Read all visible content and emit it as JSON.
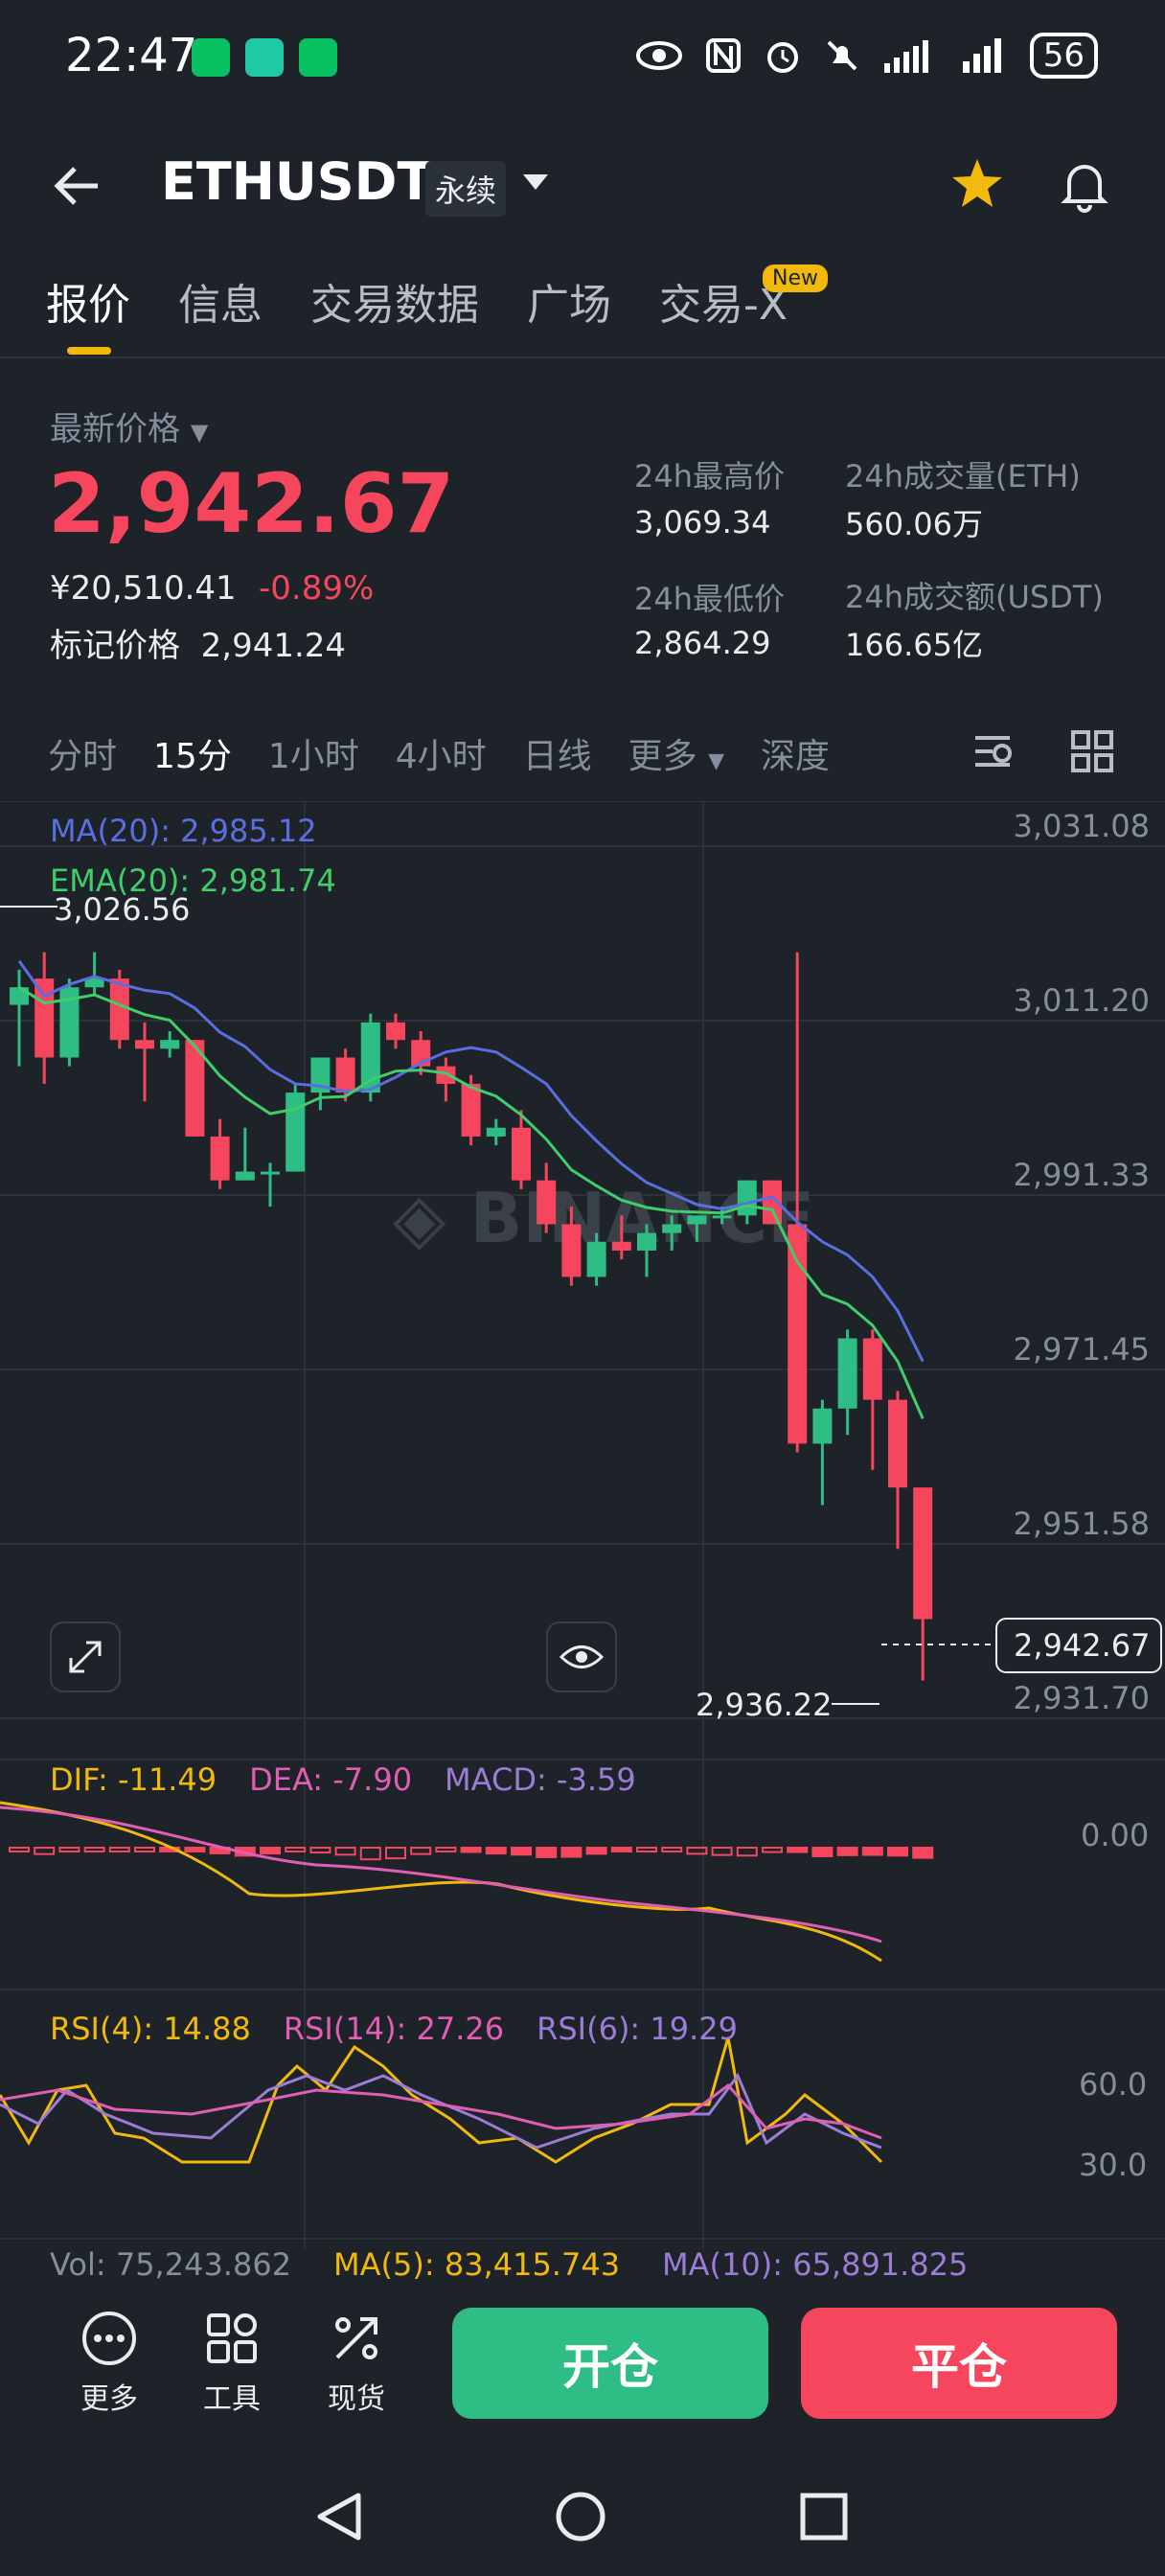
{
  "status": {
    "time": "22:47",
    "battery": "56"
  },
  "header": {
    "pair": "ETHUSDT",
    "contract_type": "永续"
  },
  "tabs": [
    {
      "label": "报价"
    },
    {
      "label": "信息"
    },
    {
      "label": "交易数据"
    },
    {
      "label": "广场"
    },
    {
      "label": "交易-X"
    }
  ],
  "new_badge": "New",
  "price_block": {
    "latest_label": "最新价格",
    "last_price": "2,942.67",
    "cny_price": "¥20,510.41",
    "change_pct": "-0.89%",
    "mark_label": "标记价格",
    "mark_price": "2,941.24"
  },
  "stats": {
    "high_label": "24h最高价",
    "high": "3,069.34",
    "low_label": "24h最低价",
    "low": "2,864.29",
    "vol_eth_label": "24h成交量(ETH)",
    "vol_eth": "560.06万",
    "vol_usdt_label": "24h成交额(USDT)",
    "vol_usdt": "166.65亿"
  },
  "intervals": [
    "分时",
    "15分",
    "1小时",
    "4小时",
    "日线",
    "更多",
    "深度"
  ],
  "chart_data": {
    "type": "candlestick",
    "ma_legend": "MA(20): 2,985.12",
    "ema_legend": "EMA(20): 2,981.74",
    "y_ticks": [
      "3,031.08",
      "3,011.20",
      "2,991.33",
      "2,971.45",
      "2,951.58",
      "2,931.70"
    ],
    "ylim": [
      2931.7,
      3031.08
    ],
    "high_annotation": "3,026.56",
    "low_annotation": "2,936.22",
    "current_price_tag": "2,942.67",
    "candles": [
      [
        3013,
        3017,
        3006,
        3015
      ],
      [
        3016,
        3019,
        3004,
        3007
      ],
      [
        3007,
        3016,
        3006,
        3015
      ],
      [
        3015,
        3019,
        3014,
        3016
      ],
      [
        3016,
        3017,
        3008,
        3009
      ],
      [
        3009,
        3011,
        3002,
        3008
      ],
      [
        3008,
        3010,
        3007,
        3009
      ],
      [
        3009,
        3009,
        2998,
        2998
      ],
      [
        2998,
        3000,
        2992,
        2993
      ],
      [
        2993,
        2999,
        2993,
        2994
      ],
      [
        2994,
        2995,
        2990,
        2994
      ],
      [
        2994,
        3004,
        2994,
        3003
      ],
      [
        3003,
        3007,
        3001,
        3007
      ],
      [
        3007,
        3008,
        3002,
        3003
      ],
      [
        3003,
        3012,
        3002,
        3011
      ],
      [
        3011,
        3012,
        3008,
        3009
      ],
      [
        3009,
        3010,
        3005,
        3006
      ],
      [
        3006,
        3007,
        3002,
        3004
      ],
      [
        3004,
        3005,
        2997,
        2998
      ],
      [
        2998,
        3000,
        2997,
        2999
      ],
      [
        2999,
        3001,
        2992,
        2993
      ],
      [
        2993,
        2995,
        2987,
        2988
      ],
      [
        2988,
        2990,
        2981,
        2982
      ],
      [
        2982,
        2987,
        2981,
        2986
      ],
      [
        2986,
        2989,
        2984,
        2985
      ],
      [
        2985,
        2988,
        2982,
        2987
      ],
      [
        2987,
        2989,
        2985,
        2988
      ],
      [
        2988,
        2989,
        2986,
        2989
      ],
      [
        2989,
        2990,
        2988,
        2989
      ],
      [
        2989,
        2993,
        2988,
        2993
      ],
      [
        2993,
        2993,
        2988,
        2988
      ],
      [
        2988,
        3019,
        2962,
        2963
      ],
      [
        2963,
        2968,
        2956,
        2967
      ],
      [
        2967,
        2976,
        2964,
        2975
      ],
      [
        2975,
        2976,
        2960,
        2968
      ],
      [
        2968,
        2969,
        2951,
        2958
      ],
      [
        2958,
        2958,
        2936,
        2943
      ]
    ]
  },
  "macd": {
    "dif": "DIF: -11.49",
    "dea": "DEA: -7.90",
    "macd": "MACD: -3.59",
    "zero": "0.00"
  },
  "rsi": {
    "rsi4": "RSI(4): 14.88",
    "rsi14": "RSI(14): 27.26",
    "rsi6": "RSI(6): 19.29",
    "t60": "60.0",
    "t30": "30.0"
  },
  "vol": {
    "vol": "Vol: 75,243.862",
    "ma5": "MA(5): 83,415.743",
    "ma10": "MA(10): 65,891.825"
  },
  "bottom": {
    "more": "更多",
    "tools": "工具",
    "spot": "现货",
    "open": "开仓",
    "close": "平仓"
  },
  "colors": {
    "up": "#2ebd85",
    "down": "#f6465d",
    "accent": "#f0b90b",
    "ma": "#5b6ee1",
    "ema": "#3fcf6a"
  }
}
